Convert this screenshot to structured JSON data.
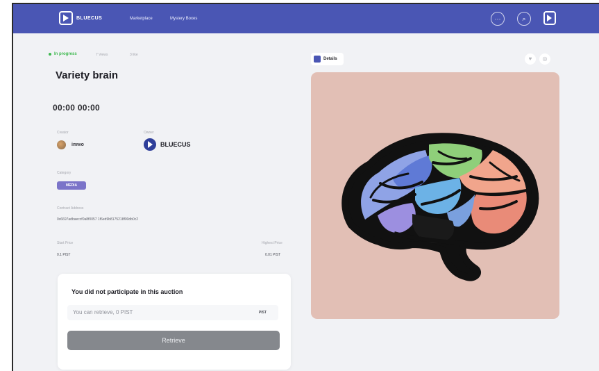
{
  "header": {
    "brand": "BLUECUS",
    "nav": [
      "Marketplace",
      "Mystery Boxes"
    ],
    "icons": [
      "more-icon",
      "search-icon",
      "account-icon"
    ]
  },
  "item": {
    "status": "In progress",
    "views": "7 Views",
    "likes": "3 like",
    "title": "Variety brain",
    "countdown": "00:00 00:00",
    "creator_label": "Creator",
    "creator_name": "imwo",
    "owner_label": "Owner",
    "owner_name": "BLUECUS",
    "category_label": "Category",
    "category": "MEDIA",
    "contract_label": "Contract Address",
    "contract_address": "0x6697adbaeccf0a8f0057 1f6ed9b8175218f00db0c2",
    "start_price_label": "Start Price",
    "start_price": "0.1 PIST",
    "highest_price_label": "Highest Price",
    "highest_price": "0.01 PIST"
  },
  "auction_card": {
    "title": "You did not participate in this auction",
    "retrieve_text": "You can retrieve, 0 PIST",
    "unit": "PIST",
    "button_label": "Retrieve"
  },
  "preview": {
    "tab_label": "Details",
    "icons": [
      "heart-icon",
      "share-icon"
    ],
    "background_color": "#e2bfb5"
  }
}
